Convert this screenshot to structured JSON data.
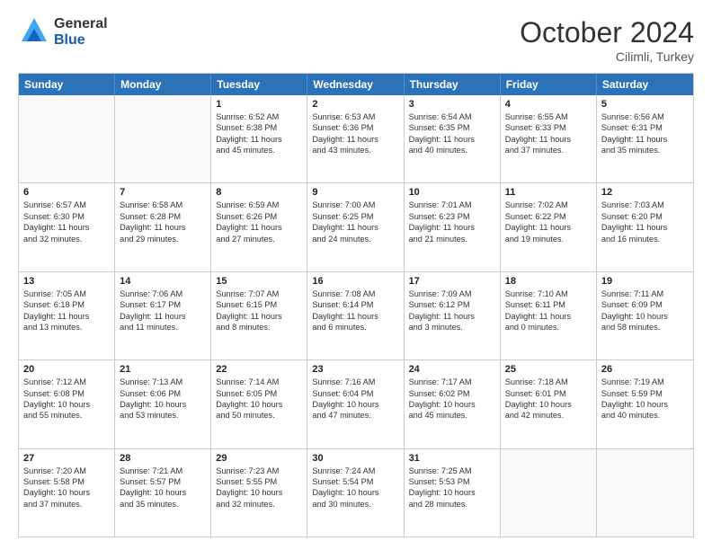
{
  "header": {
    "logo_general": "General",
    "logo_blue": "Blue",
    "month_title": "October 2024",
    "location": "Cilimli, Turkey"
  },
  "weekdays": [
    "Sunday",
    "Monday",
    "Tuesday",
    "Wednesday",
    "Thursday",
    "Friday",
    "Saturday"
  ],
  "weeks": [
    [
      {
        "day": "",
        "lines": []
      },
      {
        "day": "",
        "lines": []
      },
      {
        "day": "1",
        "lines": [
          "Sunrise: 6:52 AM",
          "Sunset: 6:38 PM",
          "Daylight: 11 hours",
          "and 45 minutes."
        ]
      },
      {
        "day": "2",
        "lines": [
          "Sunrise: 6:53 AM",
          "Sunset: 6:36 PM",
          "Daylight: 11 hours",
          "and 43 minutes."
        ]
      },
      {
        "day": "3",
        "lines": [
          "Sunrise: 6:54 AM",
          "Sunset: 6:35 PM",
          "Daylight: 11 hours",
          "and 40 minutes."
        ]
      },
      {
        "day": "4",
        "lines": [
          "Sunrise: 6:55 AM",
          "Sunset: 6:33 PM",
          "Daylight: 11 hours",
          "and 37 minutes."
        ]
      },
      {
        "day": "5",
        "lines": [
          "Sunrise: 6:56 AM",
          "Sunset: 6:31 PM",
          "Daylight: 11 hours",
          "and 35 minutes."
        ]
      }
    ],
    [
      {
        "day": "6",
        "lines": [
          "Sunrise: 6:57 AM",
          "Sunset: 6:30 PM",
          "Daylight: 11 hours",
          "and 32 minutes."
        ]
      },
      {
        "day": "7",
        "lines": [
          "Sunrise: 6:58 AM",
          "Sunset: 6:28 PM",
          "Daylight: 11 hours",
          "and 29 minutes."
        ]
      },
      {
        "day": "8",
        "lines": [
          "Sunrise: 6:59 AM",
          "Sunset: 6:26 PM",
          "Daylight: 11 hours",
          "and 27 minutes."
        ]
      },
      {
        "day": "9",
        "lines": [
          "Sunrise: 7:00 AM",
          "Sunset: 6:25 PM",
          "Daylight: 11 hours",
          "and 24 minutes."
        ]
      },
      {
        "day": "10",
        "lines": [
          "Sunrise: 7:01 AM",
          "Sunset: 6:23 PM",
          "Daylight: 11 hours",
          "and 21 minutes."
        ]
      },
      {
        "day": "11",
        "lines": [
          "Sunrise: 7:02 AM",
          "Sunset: 6:22 PM",
          "Daylight: 11 hours",
          "and 19 minutes."
        ]
      },
      {
        "day": "12",
        "lines": [
          "Sunrise: 7:03 AM",
          "Sunset: 6:20 PM",
          "Daylight: 11 hours",
          "and 16 minutes."
        ]
      }
    ],
    [
      {
        "day": "13",
        "lines": [
          "Sunrise: 7:05 AM",
          "Sunset: 6:18 PM",
          "Daylight: 11 hours",
          "and 13 minutes."
        ]
      },
      {
        "day": "14",
        "lines": [
          "Sunrise: 7:06 AM",
          "Sunset: 6:17 PM",
          "Daylight: 11 hours",
          "and 11 minutes."
        ]
      },
      {
        "day": "15",
        "lines": [
          "Sunrise: 7:07 AM",
          "Sunset: 6:15 PM",
          "Daylight: 11 hours",
          "and 8 minutes."
        ]
      },
      {
        "day": "16",
        "lines": [
          "Sunrise: 7:08 AM",
          "Sunset: 6:14 PM",
          "Daylight: 11 hours",
          "and 6 minutes."
        ]
      },
      {
        "day": "17",
        "lines": [
          "Sunrise: 7:09 AM",
          "Sunset: 6:12 PM",
          "Daylight: 11 hours",
          "and 3 minutes."
        ]
      },
      {
        "day": "18",
        "lines": [
          "Sunrise: 7:10 AM",
          "Sunset: 6:11 PM",
          "Daylight: 11 hours",
          "and 0 minutes."
        ]
      },
      {
        "day": "19",
        "lines": [
          "Sunrise: 7:11 AM",
          "Sunset: 6:09 PM",
          "Daylight: 10 hours",
          "and 58 minutes."
        ]
      }
    ],
    [
      {
        "day": "20",
        "lines": [
          "Sunrise: 7:12 AM",
          "Sunset: 6:08 PM",
          "Daylight: 10 hours",
          "and 55 minutes."
        ]
      },
      {
        "day": "21",
        "lines": [
          "Sunrise: 7:13 AM",
          "Sunset: 6:06 PM",
          "Daylight: 10 hours",
          "and 53 minutes."
        ]
      },
      {
        "day": "22",
        "lines": [
          "Sunrise: 7:14 AM",
          "Sunset: 6:05 PM",
          "Daylight: 10 hours",
          "and 50 minutes."
        ]
      },
      {
        "day": "23",
        "lines": [
          "Sunrise: 7:16 AM",
          "Sunset: 6:04 PM",
          "Daylight: 10 hours",
          "and 47 minutes."
        ]
      },
      {
        "day": "24",
        "lines": [
          "Sunrise: 7:17 AM",
          "Sunset: 6:02 PM",
          "Daylight: 10 hours",
          "and 45 minutes."
        ]
      },
      {
        "day": "25",
        "lines": [
          "Sunrise: 7:18 AM",
          "Sunset: 6:01 PM",
          "Daylight: 10 hours",
          "and 42 minutes."
        ]
      },
      {
        "day": "26",
        "lines": [
          "Sunrise: 7:19 AM",
          "Sunset: 5:59 PM",
          "Daylight: 10 hours",
          "and 40 minutes."
        ]
      }
    ],
    [
      {
        "day": "27",
        "lines": [
          "Sunrise: 7:20 AM",
          "Sunset: 5:58 PM",
          "Daylight: 10 hours",
          "and 37 minutes."
        ]
      },
      {
        "day": "28",
        "lines": [
          "Sunrise: 7:21 AM",
          "Sunset: 5:57 PM",
          "Daylight: 10 hours",
          "and 35 minutes."
        ]
      },
      {
        "day": "29",
        "lines": [
          "Sunrise: 7:23 AM",
          "Sunset: 5:55 PM",
          "Daylight: 10 hours",
          "and 32 minutes."
        ]
      },
      {
        "day": "30",
        "lines": [
          "Sunrise: 7:24 AM",
          "Sunset: 5:54 PM",
          "Daylight: 10 hours",
          "and 30 minutes."
        ]
      },
      {
        "day": "31",
        "lines": [
          "Sunrise: 7:25 AM",
          "Sunset: 5:53 PM",
          "Daylight: 10 hours",
          "and 28 minutes."
        ]
      },
      {
        "day": "",
        "lines": []
      },
      {
        "day": "",
        "lines": []
      }
    ]
  ]
}
